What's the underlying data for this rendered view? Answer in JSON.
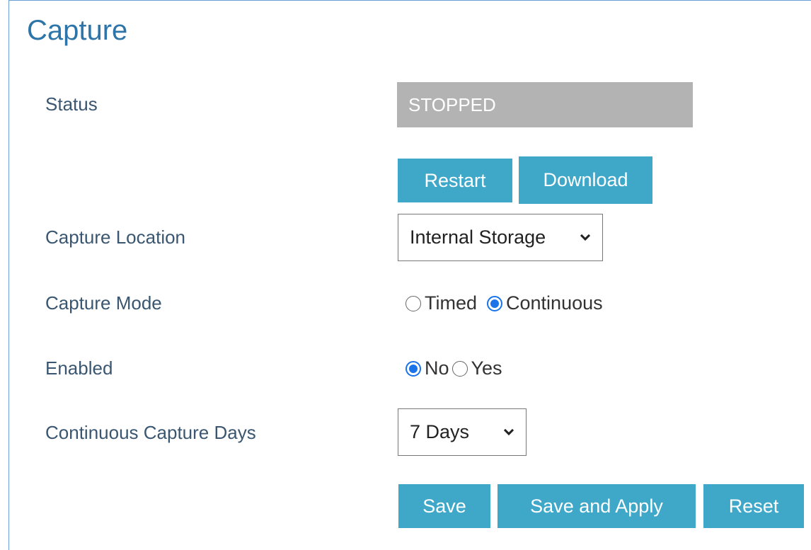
{
  "page": {
    "title": "Capture"
  },
  "status": {
    "label": "Status",
    "value": "STOPPED"
  },
  "actions_top": {
    "restart_label": "Restart",
    "download_label": "Download"
  },
  "capture_location": {
    "label": "Capture Location",
    "selected": "Internal Storage"
  },
  "capture_mode": {
    "label": "Capture Mode",
    "options": [
      "Timed",
      "Continuous"
    ],
    "selected": "Continuous"
  },
  "enabled": {
    "label": "Enabled",
    "options": [
      "No",
      "Yes"
    ],
    "selected": "No"
  },
  "continuous_days": {
    "label": "Continuous Capture Days",
    "selected": "7 Days"
  },
  "actions_bottom": {
    "save_label": "Save",
    "save_apply_label": "Save and Apply",
    "reset_label": "Reset"
  },
  "colors": {
    "title": "#2d74a8",
    "button": "#3fa8c9",
    "status_bg": "#b3b3b3",
    "radio_checked": "#1a73e8"
  }
}
